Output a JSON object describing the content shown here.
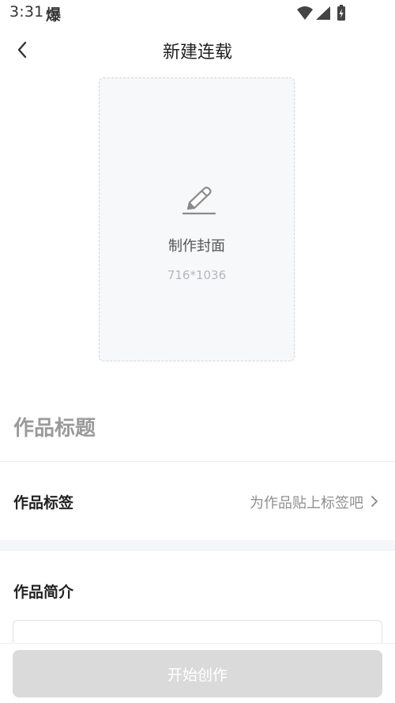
{
  "status_bar": {
    "time": "3:31",
    "app_icon_glyph": "爆",
    "icons": [
      "wifi-icon",
      "cellular-signal-icon",
      "battery-charging-icon"
    ]
  },
  "header": {
    "back_icon": "chevron-left-icon",
    "title": "新建连载"
  },
  "cover": {
    "icon": "pencil-icon",
    "label": "制作封面",
    "size_hint": "716*1036"
  },
  "title_field": {
    "placeholder": "作品标题",
    "value": ""
  },
  "tags": {
    "label": "作品标签",
    "placeholder": "为作品贴上标签吧",
    "icon": "chevron-right-icon"
  },
  "intro": {
    "label": "作品简介",
    "value": ""
  },
  "footer": {
    "start_button": "开始创作"
  },
  "colors": {
    "cover_background": "#f7f8fa",
    "divider": "#f5f6f9",
    "button_disabled": "#dadada",
    "muted_text": "#8f8f8f"
  }
}
